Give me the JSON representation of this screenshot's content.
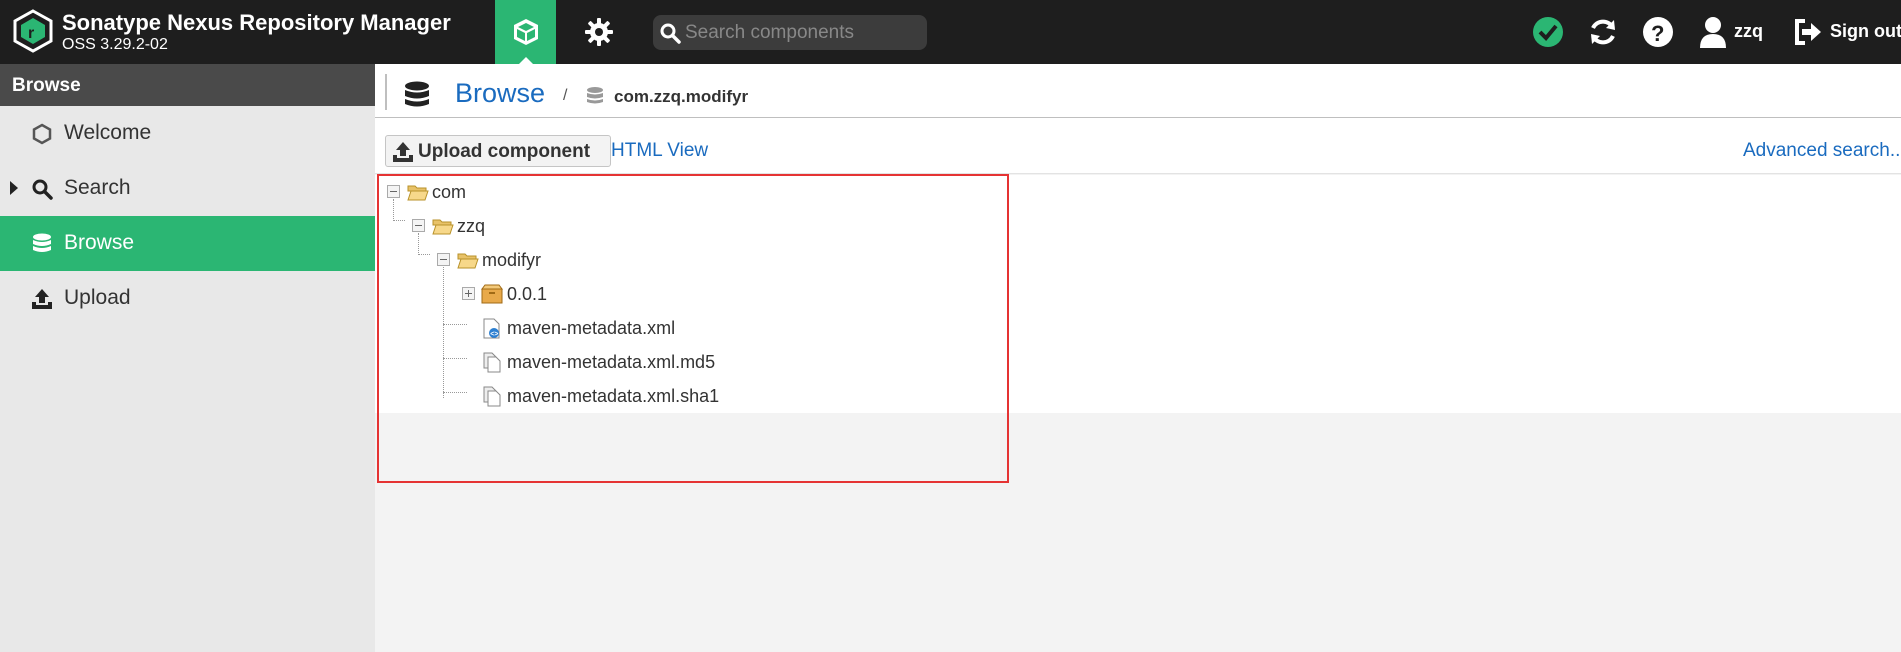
{
  "header": {
    "app_title": "Sonatype Nexus Repository Manager",
    "app_version": "OSS 3.29.2-02",
    "search_placeholder": "Search components",
    "username": "zzq",
    "signout_label": "Sign out",
    "colors": {
      "bg": "#1e1e1e",
      "accent": "#2bb673"
    }
  },
  "sidebar": {
    "title": "Browse",
    "items": [
      {
        "label": "Welcome",
        "icon": "hexagon-icon"
      },
      {
        "label": "Search",
        "icon": "search-icon"
      },
      {
        "label": "Browse",
        "icon": "database-icon",
        "active": true
      },
      {
        "label": "Upload",
        "icon": "upload-icon"
      }
    ]
  },
  "breadcrumb": {
    "title": "Browse",
    "separator": "/",
    "repository": "com.zzq.modifyr"
  },
  "toolbar": {
    "upload_label": "Upload component",
    "html_view_label": "HTML View",
    "advanced_search_label": "Advanced search..."
  },
  "tree": [
    {
      "label": "com",
      "type": "folder-open",
      "depth": 0
    },
    {
      "label": "zzq",
      "type": "folder-open",
      "depth": 1
    },
    {
      "label": "modifyr",
      "type": "folder-open",
      "depth": 2
    },
    {
      "label": "0.0.1",
      "type": "component",
      "depth": 3
    },
    {
      "label": "maven-metadata.xml",
      "type": "xml-file",
      "depth": 3
    },
    {
      "label": "maven-metadata.xml.md5",
      "type": "file",
      "depth": 3
    },
    {
      "label": "maven-metadata.xml.sha1",
      "type": "file",
      "depth": 3
    }
  ]
}
